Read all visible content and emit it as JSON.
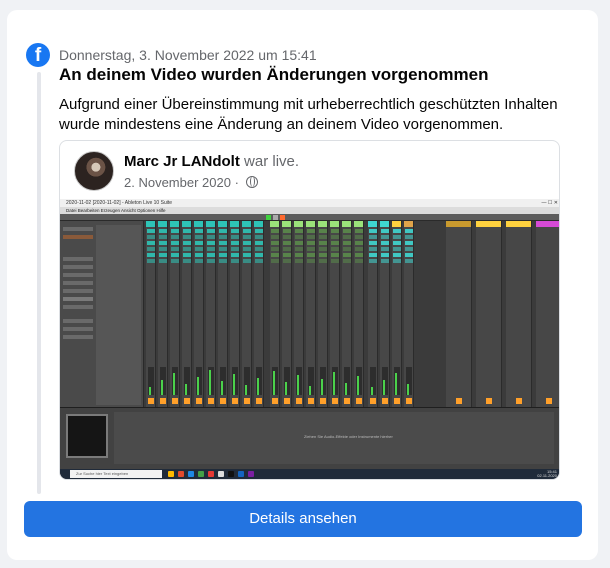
{
  "notification": {
    "date": "Donnerstag, 3. November 2022 um 15:41",
    "title": "An deinem Video wurden Änderungen vorgenommen",
    "message": "Aufgrund einer Übereinstimmung mit urheberrechtlich geschützten Inhalten wurde mindestens eine Änderung an deinem Video vorgenommen.",
    "app_icon": "facebook-icon"
  },
  "post": {
    "author": "Marc Jr LANdolt",
    "author_suffix": " war live.",
    "date": "2. November 2020 · ",
    "audience_icon": "globe-icon"
  },
  "video_screenshot": {
    "window_title": "2020-11-02 [2020-11-02] - Ableton Live 10 Suite",
    "menu": "Datei  Bearbeiten  Erzeugen  Ansicht  Optionen  Hilfe",
    "detail_hint": "Ziehen Sie Audio-Effekte oder Instrumente hierher",
    "taskbar_search": "Zur Suche hier Text eingeben",
    "clock_time": "15:41",
    "clock_date": "02.11.2020"
  },
  "actions": {
    "details_label": "Details ansehen"
  },
  "colors": {
    "accent": "#2374e1",
    "facebook_blue": "#1877f2",
    "secondary_text": "#65676b"
  }
}
